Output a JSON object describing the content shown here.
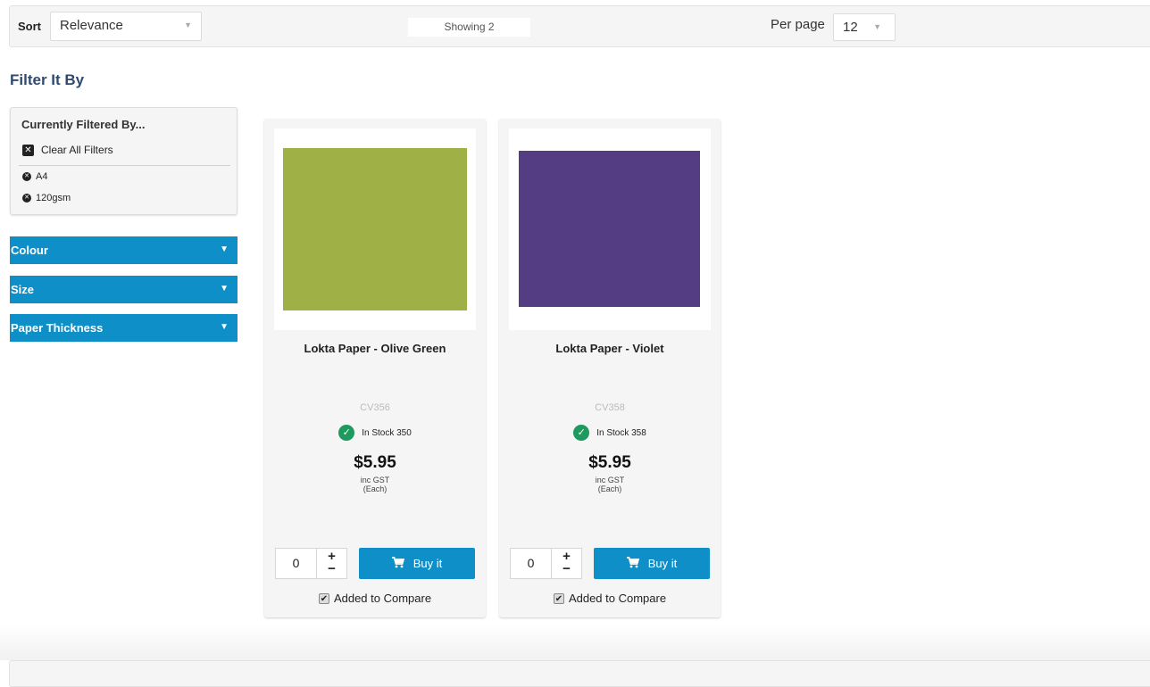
{
  "toolbar": {
    "sort_label": "Sort",
    "sort_value": "Relevance",
    "showing": "Showing 2",
    "perpage_label": "Per page",
    "perpage_value": "12"
  },
  "sidebar": {
    "heading": "Filter It By",
    "current": {
      "title": "Currently Filtered By...",
      "clear_all": "Clear All Filters",
      "filters": [
        "A4",
        "120gsm"
      ]
    },
    "facets": [
      "Colour",
      "Size",
      "Paper Thickness"
    ]
  },
  "products": [
    {
      "name": "Lokta Paper - Olive Green",
      "sku": "CV356",
      "stock": "In Stock 350",
      "price": "$5.95",
      "tax": "inc GST",
      "unit": "(Each)",
      "qty": "0",
      "buy_label": "Buy it",
      "compare_label": "Added to Compare",
      "swatch_color": "#9fb146"
    },
    {
      "name": "Lokta Paper - Violet",
      "sku": "CV358",
      "stock": "In Stock 358",
      "price": "$5.95",
      "tax": "inc GST",
      "unit": "(Each)",
      "qty": "0",
      "buy_label": "Buy it",
      "compare_label": "Added to Compare",
      "swatch_color": "#553d84"
    }
  ],
  "colors": {
    "accent": "#0e8fc8",
    "heading": "#2f4a6e",
    "stock_ok": "#1e9a5f"
  }
}
